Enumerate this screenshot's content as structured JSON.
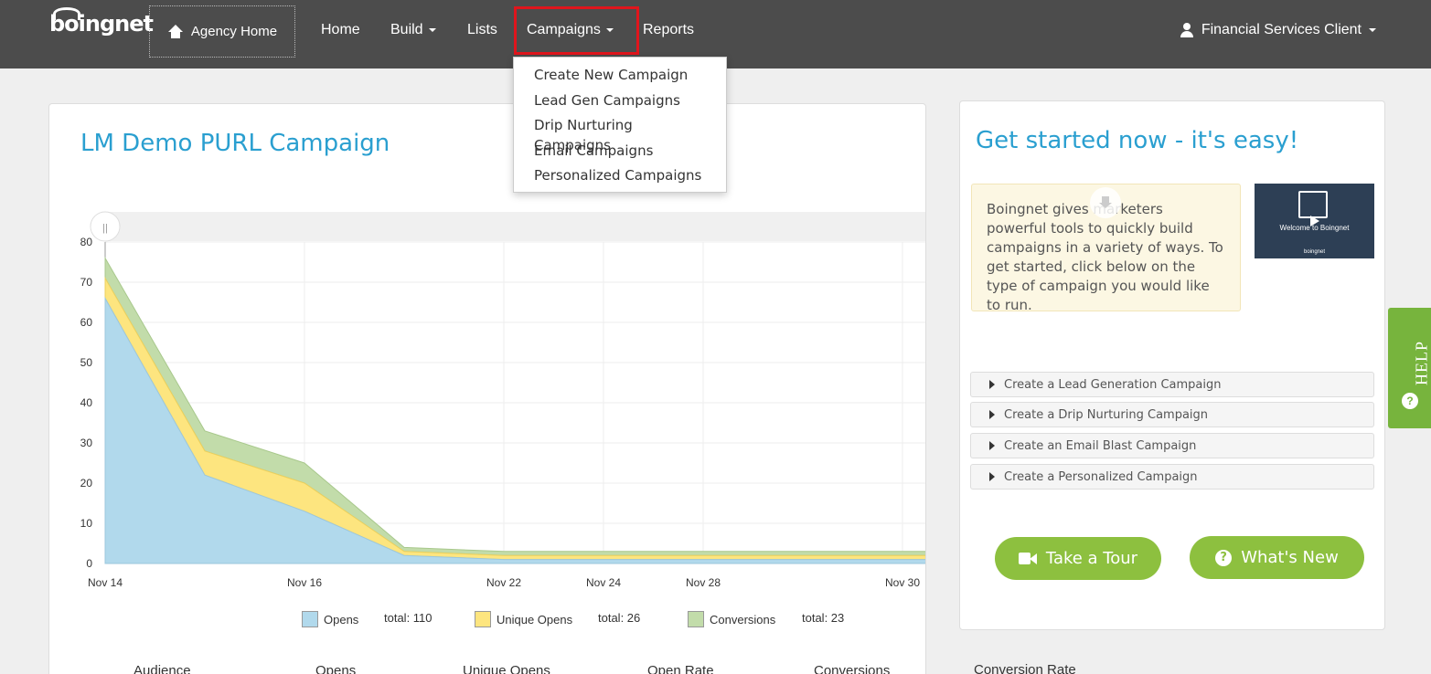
{
  "navbar": {
    "logo": "boingnet",
    "agency_home": "Agency Home",
    "items": [
      {
        "label": "Home"
      },
      {
        "label": "Build"
      },
      {
        "label": "Lists"
      },
      {
        "label": "Campaigns"
      },
      {
        "label": "Reports"
      }
    ],
    "user": "Financial Services Client"
  },
  "dropdown": {
    "items": [
      "Create New Campaign",
      "Lead Gen Campaigns",
      "Drip Nurturing Campaigns",
      "Email Campaigns",
      "Personalized Campaigns"
    ]
  },
  "campaign": {
    "title": "LM Demo PURL Campaign",
    "slider_handle": "||"
  },
  "chart_data": {
    "type": "area",
    "stacked": true,
    "ylim": [
      0,
      80
    ],
    "yticks": [
      0,
      10,
      20,
      30,
      40,
      50,
      60,
      70,
      80
    ],
    "x": [
      0,
      1,
      2,
      3,
      4,
      5,
      6,
      7,
      8,
      9
    ],
    "xtick_labels": [
      {
        "label": "Nov 14",
        "x": 0
      },
      {
        "label": "Nov 16",
        "x": 2
      },
      {
        "label": "Nov 22",
        "x": 4
      },
      {
        "label": "Nov 24",
        "x": 5
      },
      {
        "label": "Nov 28",
        "x": 6
      },
      {
        "label": "Nov 30",
        "x": 8
      }
    ],
    "series": [
      {
        "name": "Opens",
        "color": "#b1d9ec",
        "values": [
          66,
          22,
          13,
          2,
          1,
          1,
          1,
          1,
          1,
          1
        ],
        "total": "total: 110"
      },
      {
        "name": "Unique Opens",
        "color": "#fde57f",
        "values": [
          5,
          6,
          7,
          1,
          1,
          1,
          1,
          1,
          1,
          1
        ],
        "total": "total: 26"
      },
      {
        "name": "Conversions",
        "color": "#c2dcaa",
        "values": [
          5,
          5,
          5,
          1,
          1,
          1,
          1,
          1,
          1,
          1
        ],
        "total": "total: 23"
      }
    ]
  },
  "stats": {
    "headers": [
      "Audience",
      "Opens",
      "Unique Opens",
      "Open Rate",
      "Conversions",
      "Conversion Rate"
    ]
  },
  "right": {
    "title": "Get started now - it's easy!",
    "info": "Boingnet gives marketers powerful tools to quickly build campaigns in a variety of ways. To get started, click below on the type of campaign you would like to run.",
    "video_caption": "Welcome to Boingnet",
    "video_brand": "boingnet",
    "accordion": [
      "Create a Lead Generation Campaign",
      "Create a Drip Nurturing Campaign",
      "Create an Email Blast Campaign",
      "Create a Personalized Campaign"
    ],
    "tour_button": "Take a Tour",
    "whats_new_button": "What's New",
    "help_q": "?"
  },
  "help_tab": {
    "label": "HELP",
    "q": "?"
  }
}
